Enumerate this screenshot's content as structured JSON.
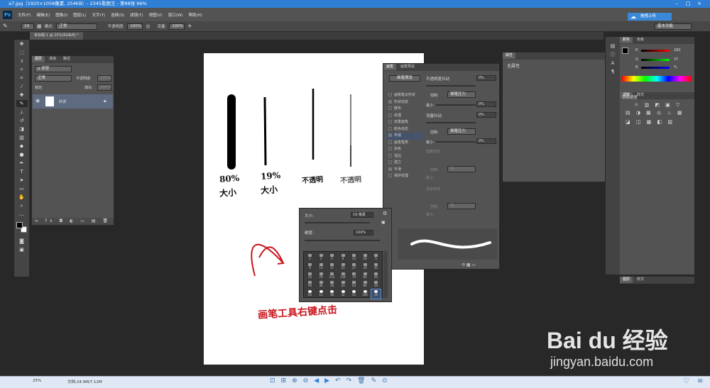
{
  "viewer": {
    "title": "a7.jpg（1920×1058像素, 254KB）- 2345看图王 - 第88张 96%",
    "upload_label": "拖拽上传",
    "zoom": "25%",
    "doc_info": "文档:24.9M/7.12M"
  },
  "photoshop": {
    "logo": "Ps",
    "menu": [
      "文件(F)",
      "编辑(E)",
      "图像(I)",
      "图层(L)",
      "文字(Y)",
      "选择(S)",
      "滤镜(T)",
      "视图(V)",
      "窗口(W)",
      "帮助(H)"
    ],
    "options": {
      "brush_size": "19",
      "mode_label": "模式:",
      "mode_value": "正常",
      "opacity_label": "不透明度:",
      "opacity_value": "100%",
      "flow_label": "流量:",
      "flow_value": "100%"
    },
    "workspace": "基本功能",
    "doc_tab": "未标题-1 @ 25%(RGB/8) *"
  },
  "layers_panel": {
    "tabs": [
      "图层",
      "通道",
      "路径"
    ],
    "kind": "ρ 类型",
    "blend": "正常",
    "opacity_label": "不透明度:",
    "opacity_value": "100%",
    "lock_label": "锁定:",
    "fill_label": "填充:",
    "fill_value": "100%",
    "layer_name": "背景"
  },
  "brush_panel": {
    "tabs": [
      "画笔",
      "画笔预设"
    ],
    "preset_btn": "画笔预设",
    "items": [
      {
        "label": "画笔笔尖形状",
        "checked": false
      },
      {
        "label": "形状动态",
        "checked": true
      },
      {
        "label": "散布",
        "checked": false
      },
      {
        "label": "纹理",
        "checked": false
      },
      {
        "label": "双重画笔",
        "checked": false
      },
      {
        "label": "颜色动态",
        "checked": false
      },
      {
        "label": "传递",
        "checked": true
      },
      {
        "label": "画笔笔势",
        "checked": false
      },
      {
        "label": "杂色",
        "checked": false
      },
      {
        "label": "湿边",
        "checked": false
      },
      {
        "label": "建立",
        "checked": false
      },
      {
        "label": "平滑",
        "checked": true
      },
      {
        "label": "保护纹理",
        "checked": false
      }
    ],
    "opacity_jitter_label": "不透明度抖动",
    "opacity_jitter_value": "0%",
    "control_label": "控制:",
    "control_value": "钢笔压力",
    "min_label": "最小:",
    "min_value": "0%",
    "flow_jitter_label": "流量抖动",
    "flow_jitter_value": "0%",
    "control2_value": "钢笔压力",
    "min2_value": "0%",
    "wet_jitter": "湿度抖动",
    "control3_value": "关",
    "mix_jitter": "混合抖动",
    "control4_value": "关"
  },
  "preset_popup": {
    "size_label": "大小:",
    "size_value": "19 像素",
    "hardness_label": "硬度:",
    "hardness_value": "100%",
    "preset_sizes": [
      "1",
      "3",
      "5",
      "9",
      "13",
      "19",
      "5",
      "9",
      "13",
      "17",
      "21",
      "27",
      "33",
      "42",
      "55",
      "70",
      "112",
      "134",
      "74",
      "95",
      "95",
      "90",
      "36",
      "36",
      "33",
      "63",
      "66",
      "39",
      "63",
      "11",
      "48",
      "32",
      "55",
      "100",
      "19"
    ],
    "selected": "19"
  },
  "properties_panel": {
    "tab": "属性",
    "content": "无属性"
  },
  "right_panels": {
    "color_tabs": [
      "颜色",
      "色板"
    ],
    "r_label": "R",
    "r_value": "280",
    "g_label": "G",
    "g_value": "37",
    "b_label": "B",
    "b_value": "%",
    "adjust_tabs": [
      "调整",
      "样式"
    ],
    "adjust_title": "添加调整",
    "bottom_tabs": [
      "图层",
      "样式"
    ]
  },
  "canvas_notes": {
    "label1_line1": "80%",
    "label1_line2": "大小",
    "label2_line1": "19%",
    "label2_line2": "大小",
    "label3": "不透明",
    "label4": "不透明",
    "annotation": "画笔工具右键点击"
  },
  "watermark": {
    "brand": "Bai du 经验",
    "url": "jingyan.baidu.com"
  },
  "colors": {
    "accent_blue": "#2f7fd6",
    "annotation_red": "#c8161d",
    "selected_layer": "#5e6a80"
  }
}
